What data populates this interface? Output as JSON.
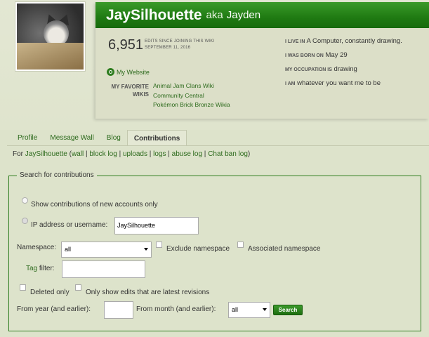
{
  "profile": {
    "user_name": "JaySilhouette",
    "aka_word": "aka",
    "aka_name": "Jayden",
    "edit_count": "6,951",
    "edits_since_line1": "EDITS SINCE JOINING THIS WIKI",
    "edits_since_line2": "SEPTEMBER 11, 2016",
    "website_label": "My Website",
    "favorite_wikis_label_1": "MY FAVORITE",
    "favorite_wikis_label_2": "WIKIS",
    "favorite_wikis": [
      "Animal Jam Clans Wiki",
      "Community Central",
      "Pokémon Brick Bronze Wikia"
    ],
    "info": [
      {
        "label": "I LIVE IN",
        "value": "A Computer, constantly drawing."
      },
      {
        "label": "I WAS BORN ON",
        "value": "May 29"
      },
      {
        "label": "MY OCCUPATION IS",
        "value": "drawing"
      },
      {
        "label": "I AM",
        "value": "whatever you want me to be"
      }
    ]
  },
  "tabs": [
    {
      "label": "Profile"
    },
    {
      "label": "Message Wall"
    },
    {
      "label": "Blog"
    },
    {
      "label": "Contributions"
    }
  ],
  "for_line": {
    "prefix": "For ",
    "user": "JaySilhouette",
    "open": " (",
    "links": [
      "wall",
      "block log",
      "uploads",
      "logs",
      "abuse log",
      "Chat ban log"
    ],
    "sep": " | ",
    "close": ")"
  },
  "search_form": {
    "legend": "Search for contributions",
    "radio_new_accounts": "Show contributions of new accounts only",
    "radio_ip_user": "IP address or username:",
    "username_value": "JaySilhouette",
    "namespace_label": "Namespace:",
    "namespace_value": "all",
    "exclude_namespace": "Exclude namespace",
    "associated_namespace": "Associated namespace",
    "tag_filter_label": "Tag",
    "tag_filter_suffix": " filter:",
    "tag_filter_value": "",
    "deleted_only": "Deleted only",
    "latest_revisions": "Only show edits that are latest revisions",
    "from_year_label": "From year (and earlier):",
    "from_year_value": "",
    "from_month_label": "From month (and earlier):",
    "from_month_value": "all",
    "search_button": "Search"
  }
}
